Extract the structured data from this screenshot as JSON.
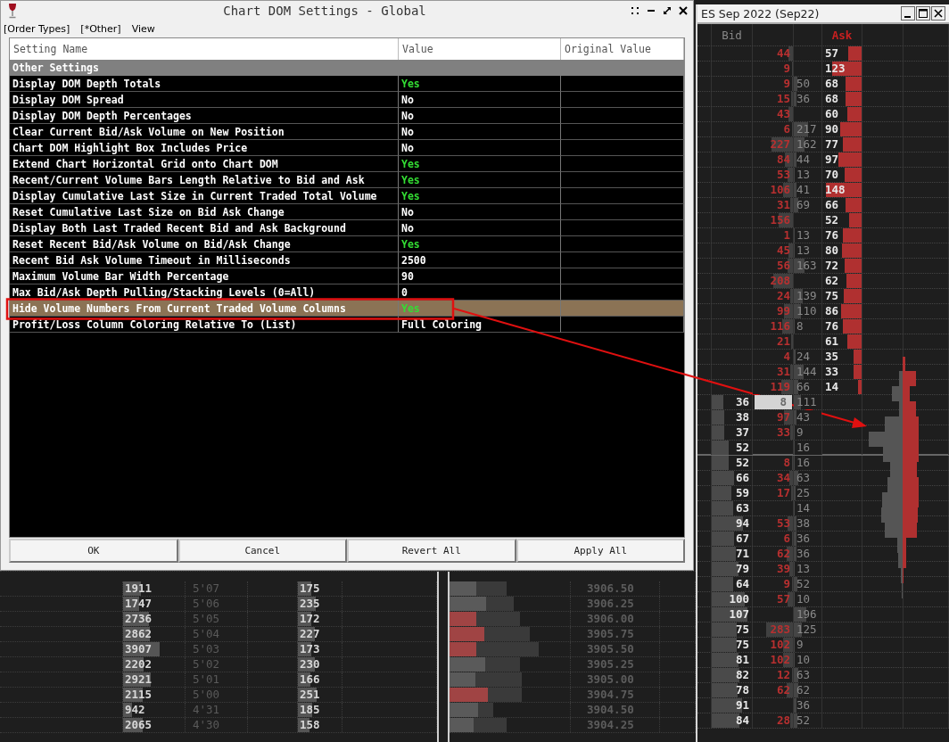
{
  "settings_dialog": {
    "title": "Chart DOM Settings - Global",
    "menu": [
      {
        "label": "[Order Types]"
      },
      {
        "label": "[*Other]"
      },
      {
        "label": "View"
      }
    ],
    "table": {
      "columns": [
        "Setting Name",
        "Value",
        "Original Value"
      ],
      "group": "Other Settings",
      "rows": [
        {
          "name": "Display DOM Depth Totals",
          "value": "Yes",
          "kind": "toggle",
          "on": true,
          "selected": false
        },
        {
          "name": "Display DOM Spread",
          "value": "No",
          "kind": "toggle",
          "on": false,
          "selected": false
        },
        {
          "name": "Display DOM Depth Percentages",
          "value": "No",
          "kind": "toggle",
          "on": false,
          "selected": false
        },
        {
          "name": "Clear Current Bid/Ask Volume on New Position",
          "value": "No",
          "kind": "toggle",
          "on": false,
          "selected": false
        },
        {
          "name": "Chart DOM Highlight Box Includes Price",
          "value": "No",
          "kind": "toggle",
          "on": false,
          "selected": false
        },
        {
          "name": "Extend Chart Horizontal Grid onto Chart DOM",
          "value": "Yes",
          "kind": "toggle",
          "on": true,
          "selected": false
        },
        {
          "name": "Recent/Current Volume Bars Length Relative to Bid and Ask",
          "value": "Yes",
          "kind": "toggle",
          "on": true,
          "selected": false
        },
        {
          "name": "Display Cumulative Last Size in Current Traded Total Volume",
          "value": "Yes",
          "kind": "toggle",
          "on": true,
          "selected": false
        },
        {
          "name": "Reset Cumulative Last Size on Bid Ask Change",
          "value": "No",
          "kind": "toggle",
          "on": false,
          "selected": false
        },
        {
          "name": "Display Both Last Traded Recent Bid and Ask Background",
          "value": "No",
          "kind": "toggle",
          "on": false,
          "selected": false
        },
        {
          "name": "Reset Recent Bid/Ask Volume on Bid/Ask Change",
          "value": "Yes",
          "kind": "toggle",
          "on": true,
          "selected": false
        },
        {
          "name": "Recent Bid Ask Volume Timeout in Milliseconds",
          "value": "2500",
          "kind": "text",
          "selected": false
        },
        {
          "name": "Maximum Volume Bar Width Percentage",
          "value": "90",
          "kind": "text",
          "selected": false
        },
        {
          "name": "Max Bid/Ask Depth Pulling/Stacking Levels (0=All)",
          "value": "0",
          "kind": "text",
          "selected": false
        },
        {
          "name": "Hide Volume Numbers From Current Traded Volume Columns",
          "value": "Yes",
          "kind": "toggle",
          "on": true,
          "selected": true
        },
        {
          "name": "Profit/Loss Column Coloring Relative To (List)",
          "value": "Full Coloring",
          "kind": "text",
          "selected": false
        }
      ]
    },
    "buttons": [
      "OK",
      "Cancel",
      "Revert All",
      "Apply All"
    ]
  },
  "dom_window": {
    "title": "ES Sep 2022 (Sep22)",
    "bid_header": "Bid",
    "ask_header": "Ask",
    "rows": [
      {
        "recent": "44",
        "ask": "57"
      },
      {
        "recent": "9",
        "ask": "123"
      },
      {
        "recent": "9",
        "traded": "50",
        "ask": "68"
      },
      {
        "recent": "15",
        "traded": "36",
        "ask": "68"
      },
      {
        "recent": "43",
        "ask": "60"
      },
      {
        "recent": "6",
        "traded": "217",
        "ask": "90"
      },
      {
        "recent": "227",
        "traded": "162",
        "ask": "77"
      },
      {
        "recent": "84",
        "traded": "44",
        "ask": "97"
      },
      {
        "recent": "53",
        "traded": "13",
        "ask": "70"
      },
      {
        "recent": "106",
        "traded": "41",
        "ask": "148"
      },
      {
        "recent": "31",
        "traded": "69",
        "ask": "66"
      },
      {
        "recent": "156",
        "ask": "52"
      },
      {
        "recent": "1",
        "traded": "13",
        "ask": "76"
      },
      {
        "recent": "45",
        "traded": "13",
        "ask": "80"
      },
      {
        "recent": "56",
        "traded": "163",
        "ask": "72"
      },
      {
        "recent": "208",
        "ask": "62"
      },
      {
        "recent": "24",
        "traded": "139",
        "ask": "75"
      },
      {
        "recent": "99",
        "traded": "110",
        "ask": "86"
      },
      {
        "recent": "116",
        "traded": "8",
        "ask": "76"
      },
      {
        "recent": "21",
        "ask": "61"
      },
      {
        "recent": "4",
        "traded": "24",
        "ask": "35"
      },
      {
        "recent": "31",
        "traded": "144",
        "ask": "33"
      },
      {
        "recent": "119",
        "traded": "66",
        "ask": "14"
      },
      {
        "bid": "36",
        "recent": "8",
        "traded": "111",
        "highlight": true
      },
      {
        "bid": "38",
        "recent": "97",
        "traded": "43"
      },
      {
        "bid": "37",
        "recent": "33",
        "traded": "9"
      },
      {
        "bid": "52",
        "traded": "16",
        "divider": true
      },
      {
        "bid": "52",
        "recent": "8",
        "traded": "16"
      },
      {
        "bid": "66",
        "recent": "34",
        "traded": "63"
      },
      {
        "bid": "59",
        "recent": "17",
        "traded": "25"
      },
      {
        "bid": "63",
        "traded": "14"
      },
      {
        "bid": "94",
        "recent": "53",
        "traded": "38"
      },
      {
        "bid": "67",
        "recent": "6",
        "traded": "36"
      },
      {
        "bid": "71",
        "recent": "62",
        "traded": "36"
      },
      {
        "bid": "79",
        "recent": "39",
        "traded": "13"
      },
      {
        "bid": "64",
        "recent": "9",
        "traded": "52"
      },
      {
        "bid": "100",
        "recent": "57",
        "traded": "10"
      },
      {
        "bid": "107",
        "traded": "196"
      },
      {
        "bid": "75",
        "recent": "283",
        "traded": "125"
      },
      {
        "bid": "75",
        "recent": "102",
        "traded": "9"
      },
      {
        "bid": "81",
        "recent": "102",
        "traded": "10"
      },
      {
        "bid": "82",
        "recent": "12",
        "traded": "63"
      },
      {
        "bid": "78",
        "recent": "62",
        "traded": "62"
      },
      {
        "bid": "91",
        "traded": "36"
      },
      {
        "bid": "84",
        "recent": "28",
        "traded": "52"
      }
    ]
  },
  "price_ladder": {
    "rows": [
      {
        "volume": "1911",
        "time": "5'07",
        "count": "175",
        "price": "3906.50",
        "color": "#5a5a5a"
      },
      {
        "volume": "1747",
        "time": "5'06",
        "count": "235",
        "price": "3906.25",
        "color": "#5a5a5a"
      },
      {
        "volume": "2736",
        "time": "5'05",
        "count": "172",
        "price": "3906.00",
        "color": "#a04444"
      },
      {
        "volume": "2862",
        "time": "5'04",
        "count": "227",
        "price": "3905.75",
        "color": "#a04444"
      },
      {
        "volume": "3907",
        "time": "5'03",
        "count": "173",
        "price": "3905.50",
        "color": "#a04444"
      },
      {
        "volume": "2202",
        "time": "5'02",
        "count": "230",
        "price": "3905.25",
        "color": "#5a5a5a"
      },
      {
        "volume": "2921",
        "time": "5'01",
        "count": "166",
        "price": "3905.00",
        "color": "#5a5a5a"
      },
      {
        "volume": "2115",
        "time": "5'00",
        "count": "251",
        "price": "3904.75",
        "color": "#a04444"
      },
      {
        "volume": "942",
        "time": "4'31",
        "count": "185",
        "price": "3904.50",
        "color": "#5a5a5a"
      },
      {
        "volume": "2065",
        "time": "4'30",
        "count": "158",
        "price": "3904.25",
        "color": "#5a5a5a"
      }
    ]
  }
}
